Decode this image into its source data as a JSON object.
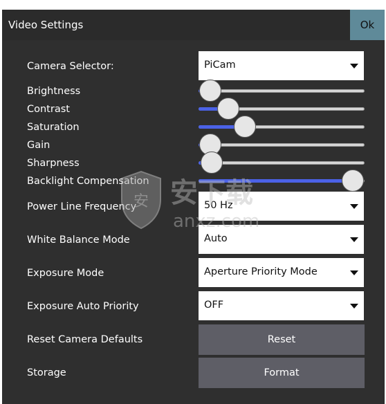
{
  "window": {
    "title": "Video Settings",
    "ok_label": "Ok"
  },
  "settings": {
    "camera_selector": {
      "label": "Camera Selector:",
      "value": "PiCam"
    },
    "sliders": [
      {
        "key": "brightness",
        "label": "Brightness",
        "level": 0.07
      },
      {
        "key": "contrast",
        "label": "Contrast",
        "level": 0.18
      },
      {
        "key": "saturation",
        "label": "Saturation",
        "level": 0.28
      },
      {
        "key": "gain",
        "label": "Gain",
        "level": 0.07
      },
      {
        "key": "sharpness",
        "label": "Sharpness",
        "level": 0.08
      },
      {
        "key": "backlight",
        "label": "Backlight Compensation",
        "level": 0.93
      }
    ],
    "power_line_frequency": {
      "label": "Power Line Frequency",
      "value": "50 Hz"
    },
    "white_balance_mode": {
      "label": "White Balance Mode",
      "value": "Auto"
    },
    "exposure_mode": {
      "label": "Exposure Mode",
      "value": "Aperture Priority Mode"
    },
    "exposure_auto_priority": {
      "label": "Exposure Auto Priority",
      "value": "OFF"
    },
    "reset_camera_defaults": {
      "label": "Reset Camera Defaults",
      "button": "Reset"
    },
    "storage": {
      "label": "Storage",
      "button": "Format"
    }
  },
  "watermark": {
    "text": "安下载",
    "subtext": "anxz.com"
  },
  "colors": {
    "accent": "#4b62e6",
    "ok_button": "#5f8a99",
    "button": "#5e5e66"
  }
}
